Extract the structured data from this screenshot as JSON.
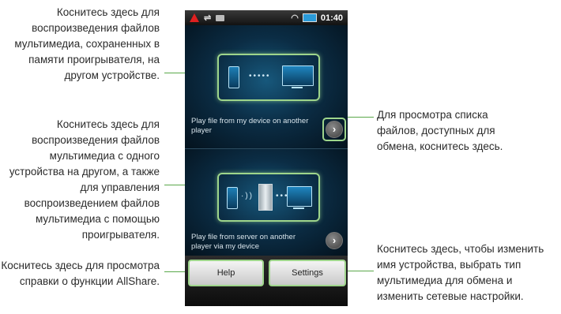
{
  "callouts": {
    "local_files": "Коснитесь здесь для воспроизведения файлов мультимедиа, сохраненных в памяти проигрывателя, на другом устройстве.",
    "server_files": "Коснитесь здесь для воспроизведения файлов мультимедиа с одного устройства на другом, а также для управления воспроизведением файлов мультимедиа с помощью проигрывателя.",
    "help": "Коснитесь здесь для просмотра справки о функции AllShare.",
    "browse_list": "Для просмотра списка файлов, доступных для обмена, коснитесь здесь.",
    "settings": "Коснитесь здесь, чтобы изменить имя устройства, выбрать тип мультимедиа для обмена и изменить сетевые настройки."
  },
  "status_bar": {
    "time": "01:40",
    "icons": [
      "warning-icon",
      "usb-icon",
      "sd-card-icon",
      "wifi-icon",
      "battery-icon"
    ]
  },
  "options": [
    {
      "label": "Play file from my device on another player"
    },
    {
      "label": "Play file from server on another player via my device"
    }
  ],
  "buttons": {
    "help": "Help",
    "settings": "Settings"
  },
  "colors": {
    "highlight": "#9ed58b",
    "callout_line": "#5aa84a",
    "panel_bg": "#0b2d45"
  }
}
